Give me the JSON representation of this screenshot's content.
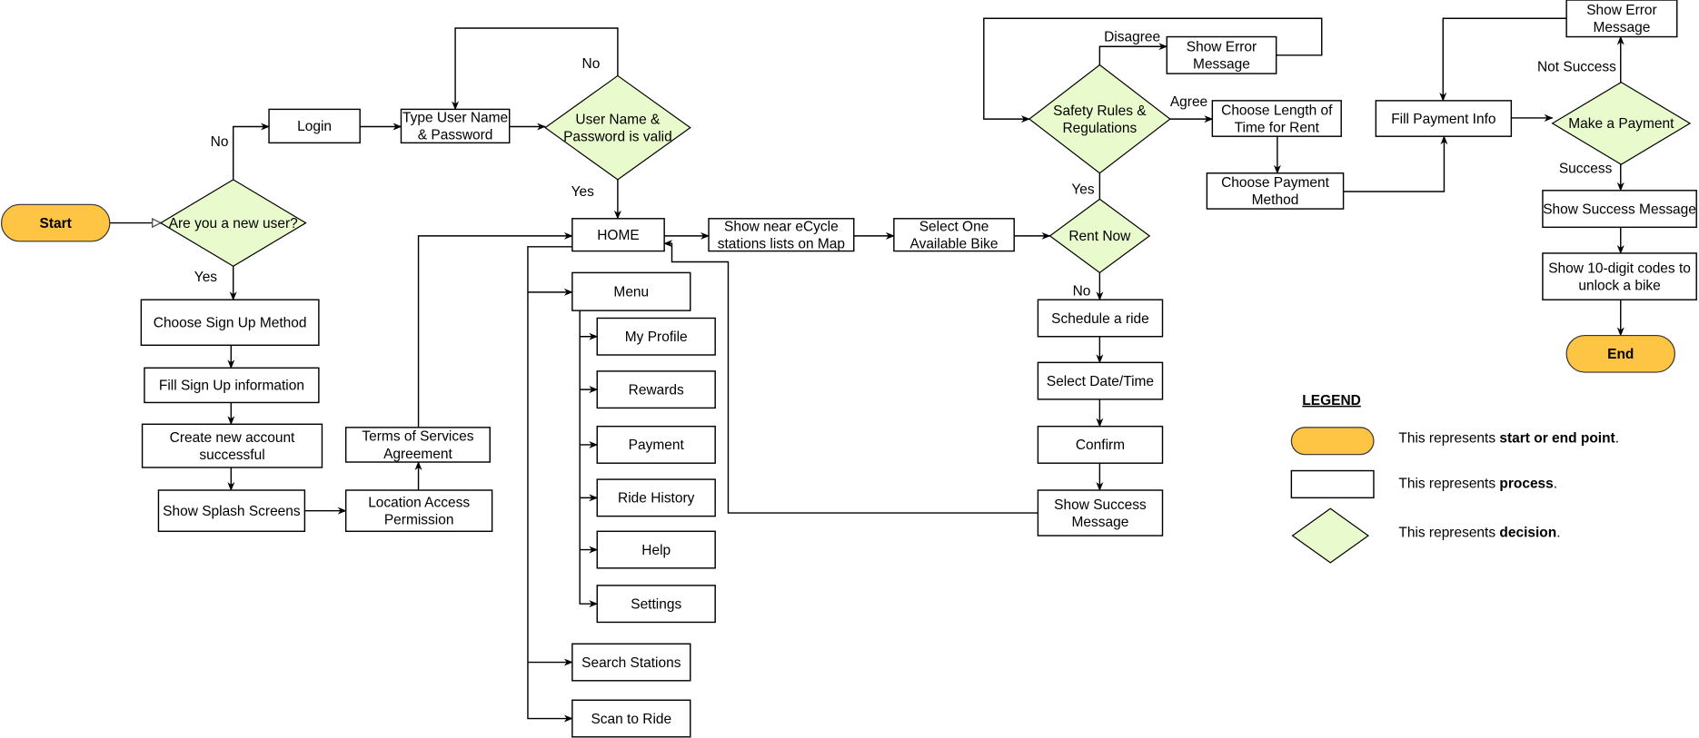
{
  "colors": {
    "terminal": "#fec444",
    "decision": "#e9fbcc",
    "process": "#ffffff",
    "line": "#000000"
  },
  "nodes": {
    "start": {
      "type": "terminal",
      "lines": [
        "Start"
      ]
    },
    "new_user": {
      "type": "decision",
      "lines": [
        "Are you a new user?"
      ]
    },
    "login": {
      "type": "process",
      "lines": [
        "Login"
      ]
    },
    "type_credentials": {
      "type": "process",
      "lines": [
        "Type User Name",
        "& Password"
      ]
    },
    "credentials_valid": {
      "type": "decision",
      "lines": [
        "User Name &",
        "Password is valid"
      ]
    },
    "home": {
      "type": "process",
      "lines": [
        "HOME"
      ]
    },
    "show_stations": {
      "type": "process",
      "lines": [
        "Show near eCycle",
        "stations lists on Map"
      ]
    },
    "select_bike": {
      "type": "process",
      "lines": [
        "Select One",
        "Available Bike"
      ]
    },
    "rent_now": {
      "type": "decision",
      "lines": [
        "Rent Now"
      ]
    },
    "safety_rules": {
      "type": "decision",
      "lines": [
        "Safety Rules &",
        "Regulations"
      ]
    },
    "error_safety": {
      "type": "process",
      "lines": [
        "Show Error",
        "Message"
      ]
    },
    "choose_length": {
      "type": "process",
      "lines": [
        "Choose Length of",
        "Time for Rent"
      ]
    },
    "choose_payment": {
      "type": "process",
      "lines": [
        "Choose Payment",
        "Method"
      ]
    },
    "fill_payment": {
      "type": "process",
      "lines": [
        "Fill Payment Info"
      ]
    },
    "make_payment": {
      "type": "decision",
      "lines": [
        "Make a Payment"
      ]
    },
    "error_payment": {
      "type": "process",
      "lines": [
        "Show Error",
        "Message"
      ]
    },
    "success_payment": {
      "type": "process",
      "lines": [
        "Show Success Message"
      ]
    },
    "show_codes": {
      "type": "process",
      "lines": [
        "Show 10-digit codes to",
        "unlock a bike"
      ]
    },
    "end": {
      "type": "terminal",
      "lines": [
        "End"
      ]
    },
    "schedule_ride": {
      "type": "process",
      "lines": [
        "Schedule a ride"
      ]
    },
    "select_datetime": {
      "type": "process",
      "lines": [
        "Select Date/Time"
      ]
    },
    "confirm": {
      "type": "process",
      "lines": [
        "Confirm"
      ]
    },
    "success_schedule": {
      "type": "process",
      "lines": [
        "Show Success",
        "Message"
      ]
    },
    "menu": {
      "type": "process",
      "lines": [
        "Menu"
      ]
    },
    "my_profile": {
      "type": "process",
      "lines": [
        "My Profile"
      ]
    },
    "rewards": {
      "type": "process",
      "lines": [
        "Rewards"
      ]
    },
    "payment": {
      "type": "process",
      "lines": [
        "Payment"
      ]
    },
    "ride_history": {
      "type": "process",
      "lines": [
        "Ride History"
      ]
    },
    "help": {
      "type": "process",
      "lines": [
        "Help"
      ]
    },
    "settings": {
      "type": "process",
      "lines": [
        "Settings"
      ]
    },
    "search_stations": {
      "type": "process",
      "lines": [
        "Search Stations"
      ]
    },
    "scan_to_ride": {
      "type": "process",
      "lines": [
        "Scan to Ride"
      ]
    },
    "choose_signup": {
      "type": "process",
      "lines": [
        "Choose Sign Up Method"
      ]
    },
    "fill_signup": {
      "type": "process",
      "lines": [
        "Fill Sign Up information"
      ]
    },
    "create_account": {
      "type": "process",
      "lines": [
        "Create new account",
        "successful"
      ]
    },
    "splash": {
      "type": "process",
      "lines": [
        "Show Splash Screens"
      ]
    },
    "location_permission": {
      "type": "process",
      "lines": [
        "Location Access",
        "Permission"
      ]
    },
    "terms": {
      "type": "process",
      "lines": [
        "Terms of Services",
        "Agreement"
      ]
    }
  },
  "edge_labels": {
    "new_user_no": "No",
    "new_user_yes": "Yes",
    "valid_no": "No",
    "valid_yes": "Yes",
    "safety_disagree": "Disagree",
    "safety_agree": "Agree",
    "safety_yes": "Yes",
    "rent_no": "No",
    "payment_not_success": "Not Success",
    "payment_success": "Success"
  },
  "legend": {
    "title": "LEGEND",
    "items": [
      {
        "shape": "terminal",
        "prefix": "This represents ",
        "emphasis": "start or end point",
        "suffix": "."
      },
      {
        "shape": "process",
        "prefix": "This represents ",
        "emphasis": "process",
        "suffix": "."
      },
      {
        "shape": "decision",
        "prefix": "This represents ",
        "emphasis": "decision",
        "suffix": "."
      }
    ]
  }
}
